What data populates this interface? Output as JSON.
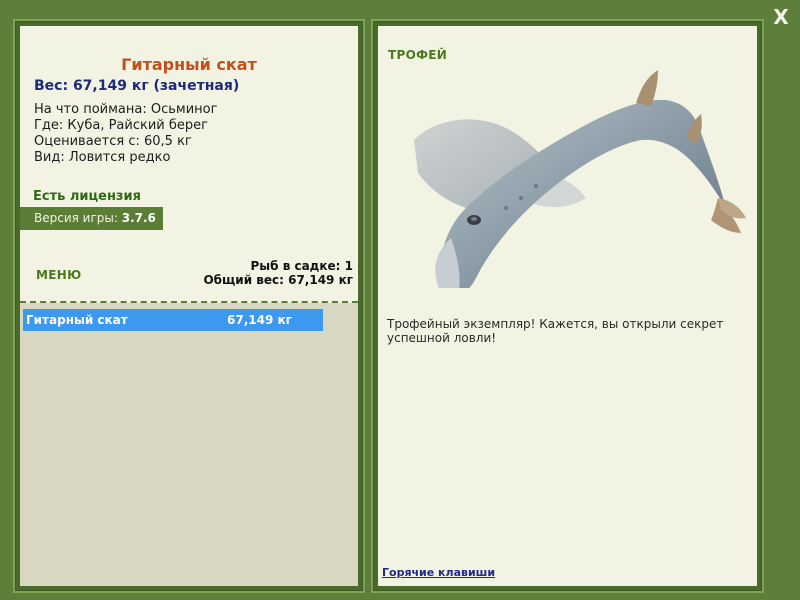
{
  "window": {
    "close_label": "X"
  },
  "left": {
    "fish_name": "Гитарный скат",
    "weight_line": "Вес: 67,149 кг (зачетная)",
    "bait": "На что поймана: Осьминог",
    "location": "Где: Куба, Райский берег",
    "value": "Оценивается с: 60,5 кг",
    "rarity": "Вид: Ловится редко",
    "license": "Есть лицензия",
    "version_label": "Версия игры: ",
    "version_value": "3.7.6",
    "menu_label": "МЕНЮ",
    "fish_count": "Рыб в садке: 1",
    "total_weight": "Общий вес: 67,149 кг",
    "catch_list": [
      {
        "name": "Гитарный скат",
        "weight": "67,149 кг"
      }
    ]
  },
  "right": {
    "heading": "ТРОФЕЙ",
    "message": "Трофейный экземпляр! Кажется, вы открыли секрет успешной ловли!",
    "hotkeys_link": "Горячие клавиши",
    "image_semantic": "guitarfish-photo"
  },
  "colors": {
    "background": "#5d7f3b",
    "panel": "#f3f3e3",
    "accent_green": "#4b7a1d",
    "title_orange": "#c2501b",
    "weight_blue": "#1c2a7a",
    "selection_blue": "#3d98f0"
  }
}
